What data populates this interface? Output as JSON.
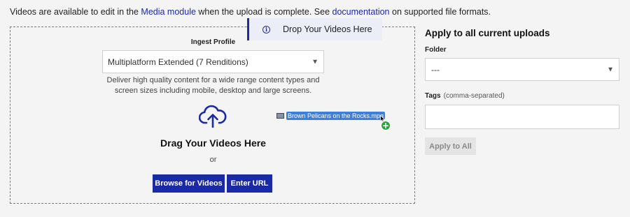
{
  "notice": {
    "prefix": "Videos are available to edit in the ",
    "media_link": "Media module",
    "middle": " when the upload is complete. See ",
    "docs_link": "documentation",
    "suffix": " on supported file formats."
  },
  "toast": {
    "text": "Drop Your Videos Here",
    "icon": "info-icon"
  },
  "dropzone": {
    "profile_label": "Ingest Profile",
    "profile_value": "Multiplatform Extended (7 Renditions)",
    "profile_description": "Deliver high quality content for a wide range content types and screen sizes including mobile, desktop and large screens.",
    "drag_title": "Drag Your Videos Here",
    "or_text": "or",
    "browse_label": "Browse for Videos",
    "url_label": "Enter URL",
    "dragged_file": "Brown Pelicans on the Rocks.mpg",
    "add_badge": "+"
  },
  "right_panel": {
    "title": "Apply to all current uploads",
    "folder_label": "Folder",
    "folder_value": "---",
    "tags_label": "Tags",
    "tags_hint": "(comma-separated)",
    "tags_value": "",
    "apply_label": "Apply to All"
  },
  "colors": {
    "accent": "#1a2aa6",
    "background": "#f4f4f4",
    "add_badge": "#2fa33b"
  }
}
